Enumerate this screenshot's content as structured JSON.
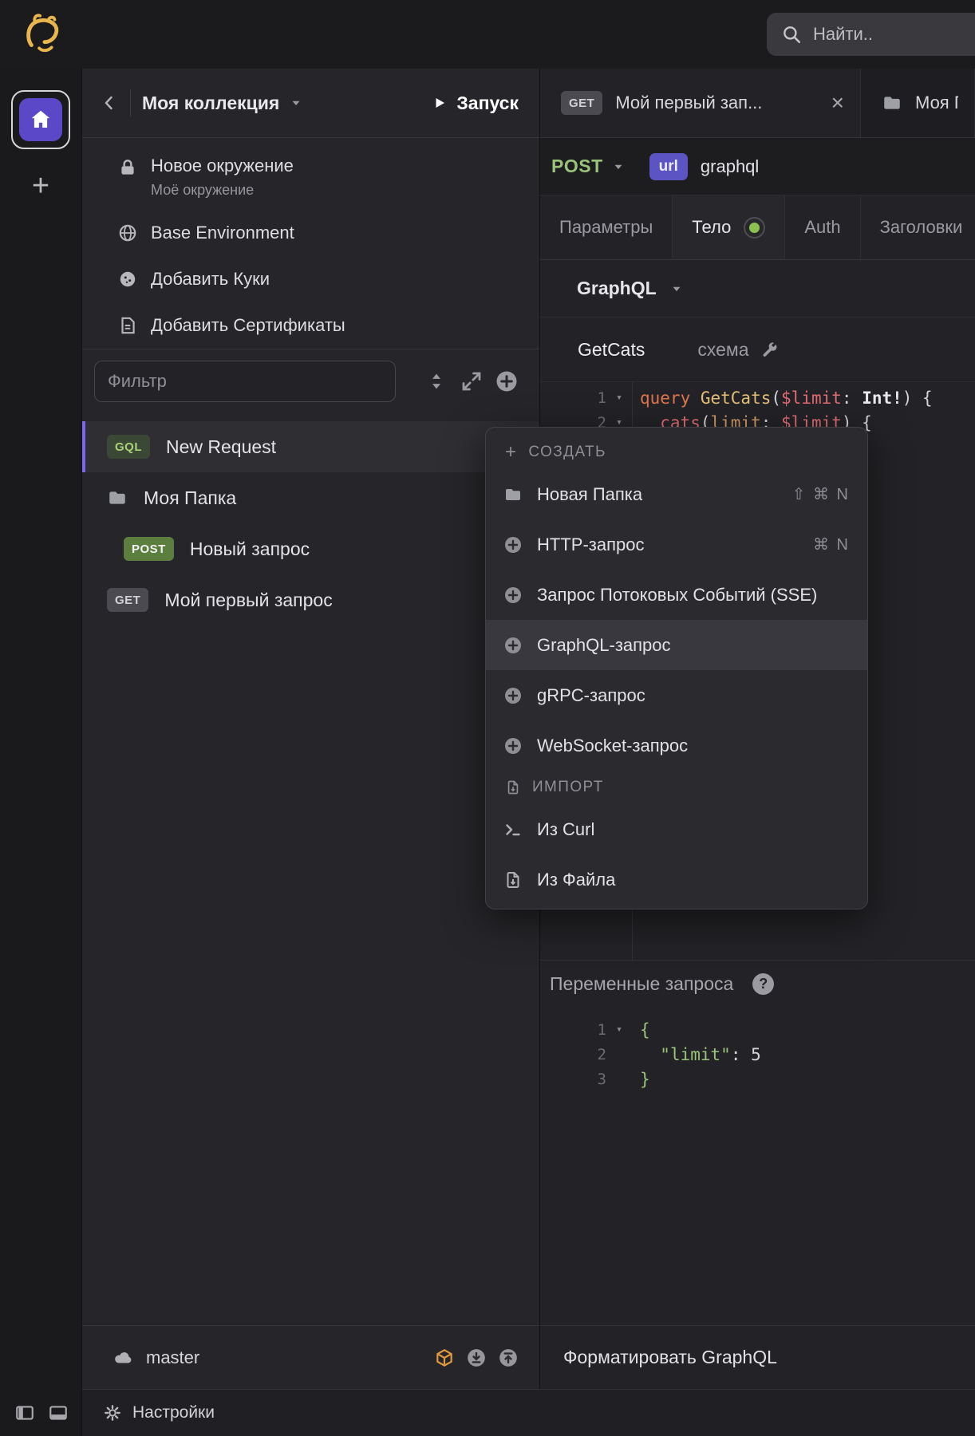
{
  "topbar": {
    "search_placeholder": "Найти.."
  },
  "sidebar": {
    "collection_title": "Моя коллекция",
    "run_label": "Запуск",
    "environment_items": [
      {
        "icon": "lock-icon",
        "label": "Новое окружение",
        "sublabel": "Моё окружение"
      },
      {
        "icon": "globe-icon",
        "label": "Base Environment"
      },
      {
        "icon": "cookie-icon",
        "label": "Добавить Куки"
      },
      {
        "icon": "certificate-icon",
        "label": "Добавить Сертификаты"
      }
    ],
    "filter_placeholder": "Фильтр",
    "tree_items": [
      {
        "badge": "GQL",
        "badge_style": "gql",
        "label": "New Request",
        "selected": true,
        "indent": 0
      },
      {
        "icon": "folder-icon",
        "label": "Моя Папка",
        "indent": 0
      },
      {
        "badge": "POST",
        "badge_style": "post",
        "label": "Новый запрос",
        "indent": 1
      },
      {
        "badge": "GET",
        "badge_style": "get",
        "label": "Мой первый запрос",
        "indent": 0
      }
    ],
    "footer": {
      "branch_icon": "cloud-icon",
      "branch": "master",
      "icons": [
        "cube-icon",
        "download-icon",
        "upload-icon"
      ]
    }
  },
  "statusbar": {
    "settings_icon": "gear-icon",
    "settings_label": "Настройки"
  },
  "main": {
    "tabs": [
      {
        "method": "GET",
        "title": "Мой первый зап...",
        "closable": true,
        "active": true
      },
      {
        "icon": "folder-icon",
        "title": "Моя Папка",
        "closable": false,
        "active": false
      }
    ],
    "request_bar": {
      "method": "POST",
      "url_scheme": "url",
      "url": "graphql"
    },
    "request_tabs": [
      {
        "label": "Параметры"
      },
      {
        "label": "Тело",
        "active": true,
        "indicator": true
      },
      {
        "label": "Auth"
      },
      {
        "label": "Заголовки"
      }
    ],
    "body_mode": "GraphQL",
    "query_tabs": [
      {
        "label": "GetCats",
        "active": true
      },
      {
        "label": "схема",
        "icon": "wrench-icon"
      }
    ],
    "editor_lines": [
      {
        "num": "1",
        "fold": true,
        "tokens": [
          [
            "query ",
            "kw"
          ],
          [
            "GetCats",
            "name"
          ],
          [
            "(",
            "punct"
          ],
          [
            "$limit",
            "var"
          ],
          [
            ": ",
            "punct"
          ],
          [
            "Int!",
            "type"
          ],
          [
            ") {",
            "punct"
          ]
        ]
      },
      {
        "num": "2",
        "fold": true,
        "tokens": [
          [
            "  cats",
            "fn"
          ],
          [
            "(",
            "punct"
          ],
          [
            "limit",
            "attr"
          ],
          [
            ": ",
            "punct"
          ],
          [
            "$limit",
            "var"
          ],
          [
            ") {",
            "punct"
          ]
        ]
      }
    ],
    "variables": {
      "title": "Переменные запроса",
      "help_icon": "question-icon",
      "lines": [
        {
          "num": "1",
          "fold": true,
          "tokens": [
            [
              "{",
              "brace"
            ]
          ]
        },
        {
          "num": "2",
          "fold": false,
          "tokens": [
            [
              "  ",
              "punct"
            ],
            [
              "\"limit\"",
              "str"
            ],
            [
              ": ",
              "punct"
            ],
            [
              "5",
              "num"
            ]
          ]
        },
        {
          "num": "3",
          "fold": false,
          "tokens": [
            [
              "}",
              "brace"
            ]
          ]
        }
      ]
    },
    "footer_action": "Форматировать GraphQL"
  },
  "context_menu": {
    "create_header": "СОЗДАТЬ",
    "create_items": [
      {
        "icon": "folder-icon",
        "label": "Новая Папка",
        "shortcut": "⇧ ⌘ N"
      },
      {
        "icon": "plus-circle-icon",
        "label": "HTTP-запрос",
        "shortcut": "⌘ N"
      },
      {
        "icon": "plus-circle-icon",
        "label": "Запрос Потоковых Событий (SSE)"
      },
      {
        "icon": "plus-circle-icon",
        "label": "GraphQL-запрос",
        "highlighted": true
      },
      {
        "icon": "plus-circle-icon",
        "label": "gRPC-запрос"
      },
      {
        "icon": "plus-circle-icon",
        "label": "WebSocket-запрос"
      }
    ],
    "import_header": "ИМПОРТ",
    "import_header_icon": "import-icon",
    "import_items": [
      {
        "icon": "terminal-icon",
        "label": "Из Curl"
      },
      {
        "icon": "import-icon",
        "label": "Из Файла"
      }
    ]
  },
  "colors": {
    "accent_purple": "#5a48c8",
    "selected_bar_purple": "#7b68ee",
    "method_green": "#98c379",
    "badge_gql_bg": "#3c4836",
    "badge_post_bg": "#5c7e3e",
    "badge_get_bg": "#4a4a50",
    "url_badge_bg": "#5d54c4",
    "indicator_green": "#8cc152",
    "cube_orange": "#e0993f"
  }
}
